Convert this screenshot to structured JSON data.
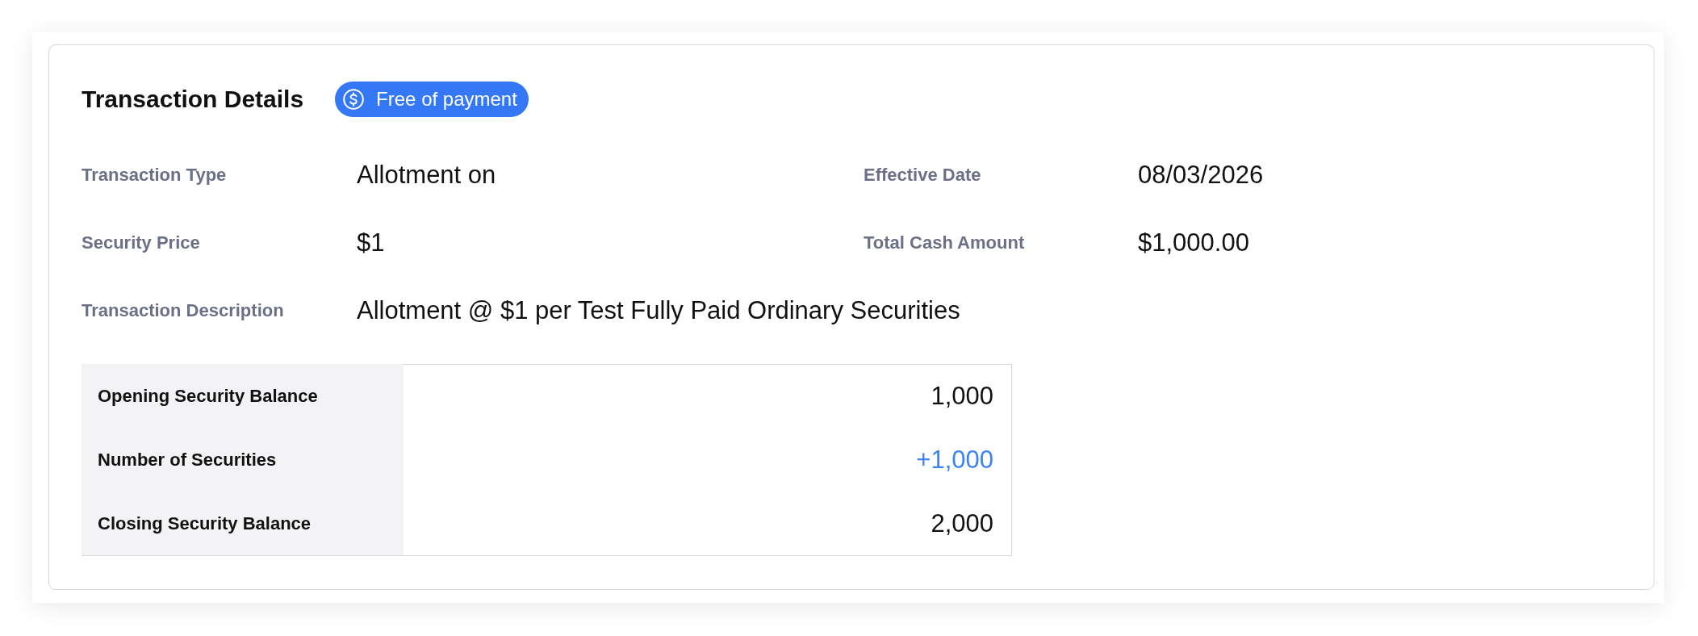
{
  "card": {
    "title": "Transaction Details",
    "badge": {
      "label": "Free of payment"
    }
  },
  "field_rows": [
    {
      "fields": [
        {
          "label": "Transaction Type",
          "value": "Allotment on"
        },
        {
          "label": "Effective Date",
          "value": "08/03/2026"
        }
      ]
    },
    {
      "fields": [
        {
          "label": "Security Price",
          "value": "$1"
        },
        {
          "label": "Total Cash Amount",
          "value": "$1,000.00"
        }
      ]
    },
    {
      "fields": [
        {
          "label": "Transaction Description",
          "value": "Allotment @ $1 per Test Fully Paid Ordinary Securities"
        }
      ]
    }
  ],
  "balances": [
    {
      "label": "Opening Security Balance",
      "value": "1,000",
      "kind": "plain"
    },
    {
      "label": "Number of Securities",
      "value": "+1,000",
      "kind": "change"
    },
    {
      "label": "Closing Security Balance",
      "value": "2,000",
      "kind": "plain"
    }
  ]
}
